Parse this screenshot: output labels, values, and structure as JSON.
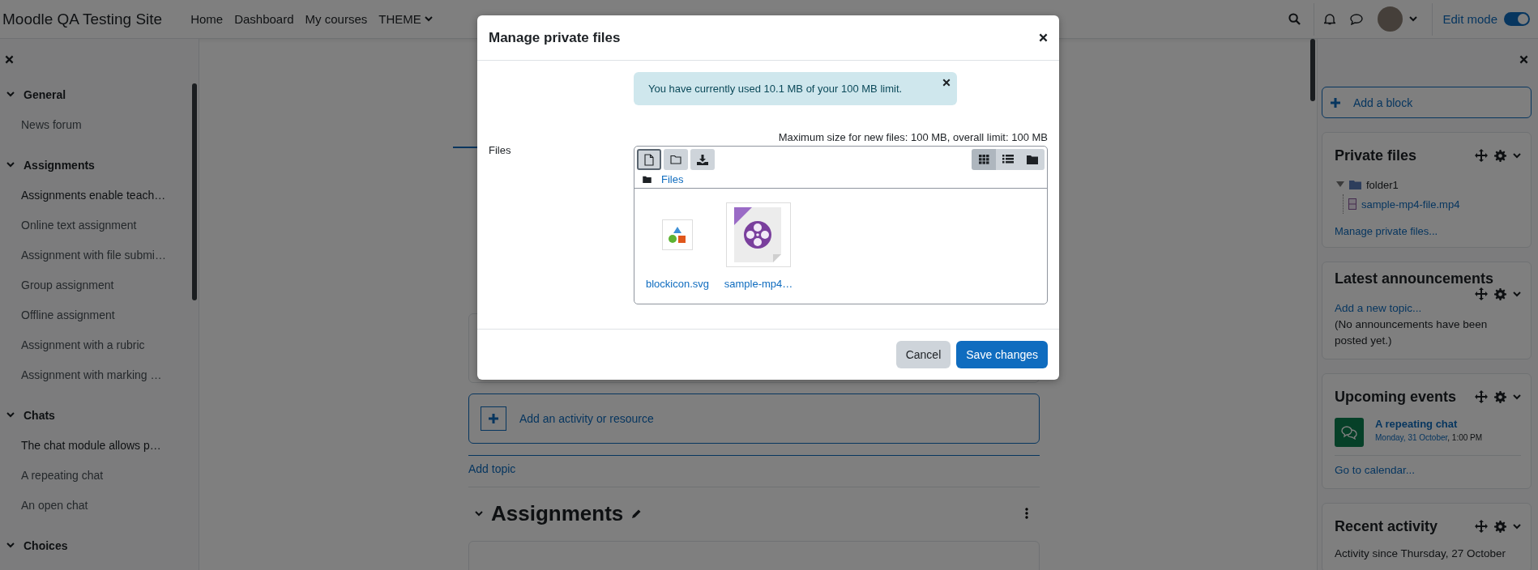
{
  "navbar": {
    "site_name": "Moodle QA Testing Site",
    "links": [
      {
        "label": "Home",
        "dropdown": false
      },
      {
        "label": "Dashboard",
        "dropdown": false
      },
      {
        "label": "My courses",
        "dropdown": false
      },
      {
        "label": "THEME",
        "dropdown": true
      }
    ],
    "edit_mode": {
      "label": "Edit mode",
      "on": true
    }
  },
  "course_index": {
    "sections": [
      {
        "title": "General",
        "expanded": true,
        "items": [
          {
            "label": "News forum",
            "kind": "activity"
          }
        ]
      },
      {
        "title": "Assignments",
        "expanded": true,
        "items": [
          {
            "label": "Assignments enable teach…",
            "kind": "label"
          },
          {
            "label": "Online text assignment",
            "kind": "activity"
          },
          {
            "label": "Assignment with file submi…",
            "kind": "activity"
          },
          {
            "label": "Group assignment",
            "kind": "activity"
          },
          {
            "label": "Offline assignment",
            "kind": "activity"
          },
          {
            "label": "Assignment with a rubric",
            "kind": "activity"
          },
          {
            "label": "Assignment with marking …",
            "kind": "activity"
          }
        ]
      },
      {
        "title": "Chats",
        "expanded": true,
        "items": [
          {
            "label": "The chat module allows p…",
            "kind": "label"
          },
          {
            "label": "A repeating chat",
            "kind": "activity"
          },
          {
            "label": "An open chat",
            "kind": "activity"
          }
        ]
      },
      {
        "title": "Choices",
        "expanded": true
      }
    ]
  },
  "course": {
    "add_activity": "Add an activity or resource",
    "add_topic": "Add topic",
    "next_section": {
      "title": "Assignments",
      "expanded": true
    }
  },
  "blocks": {
    "add_block": "Add a block",
    "private_files": {
      "title": "Private files",
      "tree": [
        {
          "label": "folder1",
          "expanded": true,
          "children": [
            {
              "label": "sample-mp4-file.mp4"
            }
          ]
        }
      ],
      "manage_link": "Manage private files..."
    },
    "latest_announcements": {
      "title": "Latest announcements",
      "add_link": "Add a new topic...",
      "empty_text": "(No announcements have been posted yet.)"
    },
    "upcoming_events": {
      "title": "Upcoming events",
      "events": [
        {
          "title": "A repeating chat",
          "date": "Monday, 31 October",
          "time": ", 1:00 PM"
        }
      ],
      "calendar_link": "Go to calendar..."
    },
    "recent_activity": {
      "title": "Recent activity",
      "text": "Activity since Thursday, 27 October"
    }
  },
  "modal": {
    "title": "Manage private files",
    "alert": "You have currently used 10.1 MB of your 100 MB limit.",
    "field_label": "Files",
    "limits": "Maximum size for new files: 100 MB, overall limit: 100 MB",
    "breadcrumb": "Files",
    "views": [
      {
        "kind": "icons",
        "selected": true
      },
      {
        "kind": "list",
        "selected": false
      },
      {
        "kind": "tree",
        "selected": false
      }
    ],
    "files": [
      {
        "name": "blockicon.svg",
        "kind": "image"
      },
      {
        "name": "sample-mp4…",
        "kind": "video"
      }
    ],
    "buttons": [
      {
        "label": "Cancel",
        "kind": "secondary"
      },
      {
        "label": "Save changes",
        "kind": "primary"
      }
    ]
  }
}
